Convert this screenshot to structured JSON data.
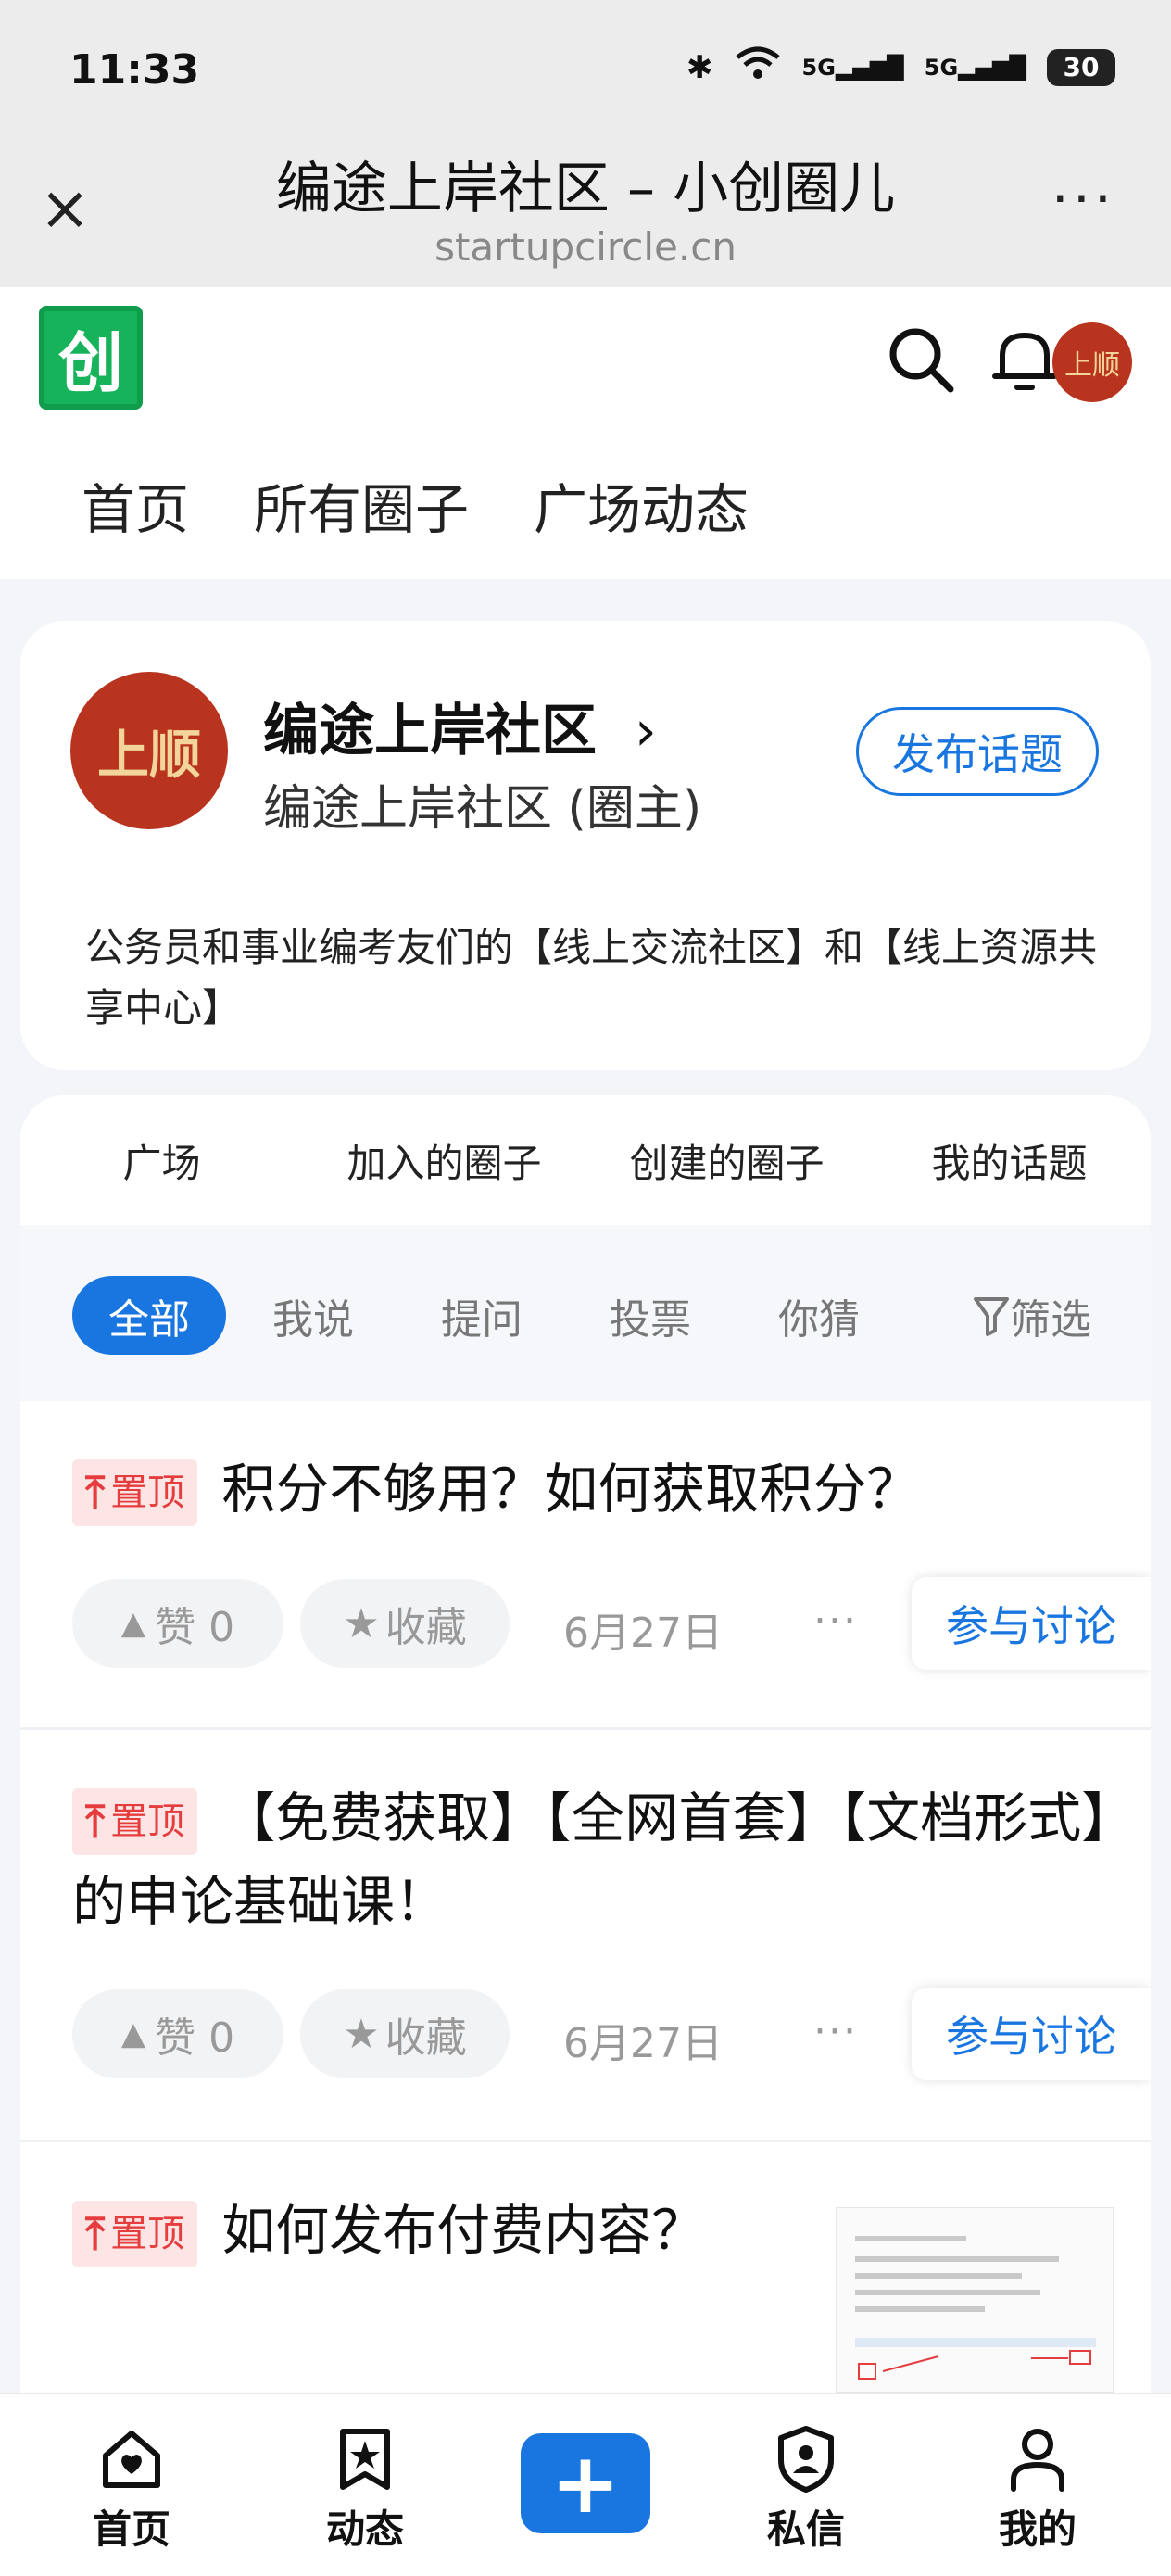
{
  "status": {
    "time": "11:33",
    "battery": "30",
    "signal1": "5G",
    "signal2": "5G"
  },
  "browser": {
    "title": "编途上岸社区 – 小创圈儿",
    "url": "startupcircle.cn"
  },
  "header": {
    "logo_text": "创"
  },
  "top_nav": [
    "首页",
    "所有圈子",
    "广场动态"
  ],
  "community": {
    "name": "编途上岸社区",
    "chevron": "›",
    "subtitle": "编途上岸社区 (圈主)",
    "publish_label": "发布话题",
    "description": "公务员和事业编考友们的【线上交流社区】和【线上资源共享中心】"
  },
  "sub_tabs": [
    "广场",
    "加入的圈子",
    "创建的圈子",
    "我的话题"
  ],
  "filters": {
    "all": "全部",
    "say": "我说",
    "ask": "提问",
    "vote": "投票",
    "guess": "你猜",
    "filter": "筛选"
  },
  "posts": [
    {
      "pin": "置顶",
      "title": "积分不够用？如何获取积分？",
      "like": "赞 0",
      "fav": "收藏",
      "date": "6月27日",
      "more": "···",
      "discuss": "参与讨论"
    },
    {
      "pin": "置顶",
      "title": "【免费获取】【全网首套】【文档形式】的申论基础课！",
      "like": "赞 0",
      "fav": "收藏",
      "date": "6月27日",
      "more": "···",
      "discuss": "参与讨论"
    },
    {
      "pin": "置顶",
      "title": "如何发布付费内容？"
    }
  ],
  "bottom_nav": {
    "home": "首页",
    "feed": "动态",
    "messages": "私信",
    "me": "我的",
    "plus": "+"
  },
  "colors": {
    "accent": "#1976e0",
    "pin": "#e53d3d",
    "logo": "#16b35b"
  }
}
